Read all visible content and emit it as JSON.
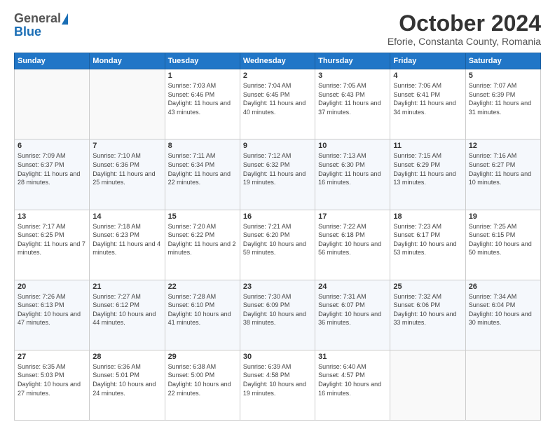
{
  "header": {
    "logo_general": "General",
    "logo_blue": "Blue",
    "month_title": "October 2024",
    "location": "Eforie, Constanta County, Romania"
  },
  "weekdays": [
    "Sunday",
    "Monday",
    "Tuesday",
    "Wednesday",
    "Thursday",
    "Friday",
    "Saturday"
  ],
  "weeks": [
    [
      {
        "day": "",
        "info": ""
      },
      {
        "day": "",
        "info": ""
      },
      {
        "day": "1",
        "info": "Sunrise: 7:03 AM\nSunset: 6:46 PM\nDaylight: 11 hours and 43 minutes."
      },
      {
        "day": "2",
        "info": "Sunrise: 7:04 AM\nSunset: 6:45 PM\nDaylight: 11 hours and 40 minutes."
      },
      {
        "day": "3",
        "info": "Sunrise: 7:05 AM\nSunset: 6:43 PM\nDaylight: 11 hours and 37 minutes."
      },
      {
        "day": "4",
        "info": "Sunrise: 7:06 AM\nSunset: 6:41 PM\nDaylight: 11 hours and 34 minutes."
      },
      {
        "day": "5",
        "info": "Sunrise: 7:07 AM\nSunset: 6:39 PM\nDaylight: 11 hours and 31 minutes."
      }
    ],
    [
      {
        "day": "6",
        "info": "Sunrise: 7:09 AM\nSunset: 6:37 PM\nDaylight: 11 hours and 28 minutes."
      },
      {
        "day": "7",
        "info": "Sunrise: 7:10 AM\nSunset: 6:36 PM\nDaylight: 11 hours and 25 minutes."
      },
      {
        "day": "8",
        "info": "Sunrise: 7:11 AM\nSunset: 6:34 PM\nDaylight: 11 hours and 22 minutes."
      },
      {
        "day": "9",
        "info": "Sunrise: 7:12 AM\nSunset: 6:32 PM\nDaylight: 11 hours and 19 minutes."
      },
      {
        "day": "10",
        "info": "Sunrise: 7:13 AM\nSunset: 6:30 PM\nDaylight: 11 hours and 16 minutes."
      },
      {
        "day": "11",
        "info": "Sunrise: 7:15 AM\nSunset: 6:29 PM\nDaylight: 11 hours and 13 minutes."
      },
      {
        "day": "12",
        "info": "Sunrise: 7:16 AM\nSunset: 6:27 PM\nDaylight: 11 hours and 10 minutes."
      }
    ],
    [
      {
        "day": "13",
        "info": "Sunrise: 7:17 AM\nSunset: 6:25 PM\nDaylight: 11 hours and 7 minutes."
      },
      {
        "day": "14",
        "info": "Sunrise: 7:18 AM\nSunset: 6:23 PM\nDaylight: 11 hours and 4 minutes."
      },
      {
        "day": "15",
        "info": "Sunrise: 7:20 AM\nSunset: 6:22 PM\nDaylight: 11 hours and 2 minutes."
      },
      {
        "day": "16",
        "info": "Sunrise: 7:21 AM\nSunset: 6:20 PM\nDaylight: 10 hours and 59 minutes."
      },
      {
        "day": "17",
        "info": "Sunrise: 7:22 AM\nSunset: 6:18 PM\nDaylight: 10 hours and 56 minutes."
      },
      {
        "day": "18",
        "info": "Sunrise: 7:23 AM\nSunset: 6:17 PM\nDaylight: 10 hours and 53 minutes."
      },
      {
        "day": "19",
        "info": "Sunrise: 7:25 AM\nSunset: 6:15 PM\nDaylight: 10 hours and 50 minutes."
      }
    ],
    [
      {
        "day": "20",
        "info": "Sunrise: 7:26 AM\nSunset: 6:13 PM\nDaylight: 10 hours and 47 minutes."
      },
      {
        "day": "21",
        "info": "Sunrise: 7:27 AM\nSunset: 6:12 PM\nDaylight: 10 hours and 44 minutes."
      },
      {
        "day": "22",
        "info": "Sunrise: 7:28 AM\nSunset: 6:10 PM\nDaylight: 10 hours and 41 minutes."
      },
      {
        "day": "23",
        "info": "Sunrise: 7:30 AM\nSunset: 6:09 PM\nDaylight: 10 hours and 38 minutes."
      },
      {
        "day": "24",
        "info": "Sunrise: 7:31 AM\nSunset: 6:07 PM\nDaylight: 10 hours and 36 minutes."
      },
      {
        "day": "25",
        "info": "Sunrise: 7:32 AM\nSunset: 6:06 PM\nDaylight: 10 hours and 33 minutes."
      },
      {
        "day": "26",
        "info": "Sunrise: 7:34 AM\nSunset: 6:04 PM\nDaylight: 10 hours and 30 minutes."
      }
    ],
    [
      {
        "day": "27",
        "info": "Sunrise: 6:35 AM\nSunset: 5:03 PM\nDaylight: 10 hours and 27 minutes."
      },
      {
        "day": "28",
        "info": "Sunrise: 6:36 AM\nSunset: 5:01 PM\nDaylight: 10 hours and 24 minutes."
      },
      {
        "day": "29",
        "info": "Sunrise: 6:38 AM\nSunset: 5:00 PM\nDaylight: 10 hours and 22 minutes."
      },
      {
        "day": "30",
        "info": "Sunrise: 6:39 AM\nSunset: 4:58 PM\nDaylight: 10 hours and 19 minutes."
      },
      {
        "day": "31",
        "info": "Sunrise: 6:40 AM\nSunset: 4:57 PM\nDaylight: 10 hours and 16 minutes."
      },
      {
        "day": "",
        "info": ""
      },
      {
        "day": "",
        "info": ""
      }
    ]
  ]
}
